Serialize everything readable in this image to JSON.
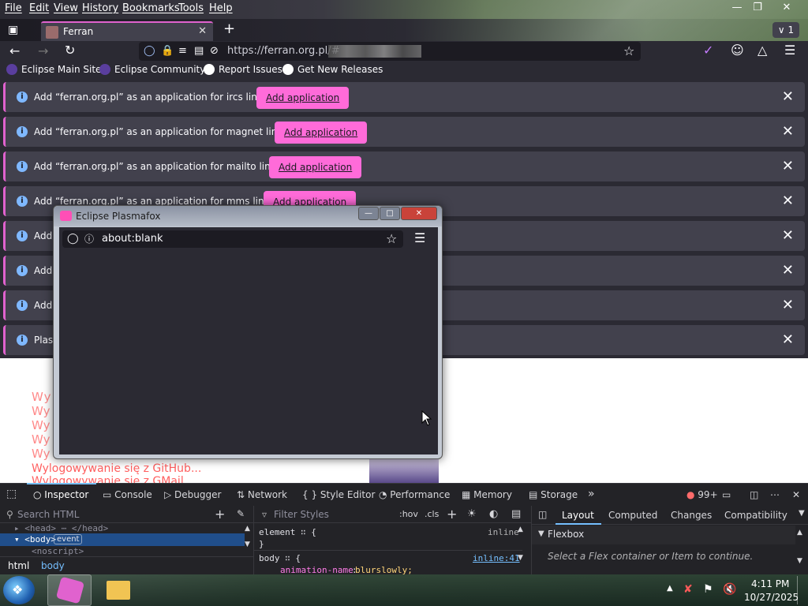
{
  "menubar": {
    "items": [
      "File",
      "Edit",
      "View",
      "History",
      "Bookmarks",
      "Tools",
      "Help"
    ]
  },
  "tabs": {
    "active_title": "Ferran",
    "count_badge": "1"
  },
  "navbar": {
    "url": "https://ferran.org.pl/#"
  },
  "bookmarks": [
    "Eclipse Main Site",
    "Eclipse Community",
    "Report Issues",
    "Get New Releases"
  ],
  "notifications": [
    {
      "message": "Add “ferran.org.pl” as an application for ircs links?",
      "button": "Add application"
    },
    {
      "message": "Add “ferran.org.pl” as an application for magnet links?",
      "button": "Add application"
    },
    {
      "message": "Add “ferran.org.pl” as an application for mailto links?",
      "button": "Add application"
    },
    {
      "message": "Add “ferran.org.pl” as an application for mms links?",
      "button": "Add application"
    },
    {
      "message": "Add",
      "button": ""
    },
    {
      "message": "Add",
      "button": ""
    },
    {
      "message": "Add",
      "button": ""
    },
    {
      "message": "Plasr",
      "button": ""
    }
  ],
  "page": {
    "lines": [
      "Wylogowywanie się z GitHub...",
      "Wylogowywanie się z GMail..."
    ]
  },
  "popup": {
    "title": "Eclipse Plasmafox",
    "url": "about:blank"
  },
  "devtools": {
    "tabs": [
      "Inspector",
      "Console",
      "Debugger",
      "Network",
      "Style Editor",
      "Performance",
      "Memory",
      "Storage"
    ],
    "error_count": "99+",
    "search_placeholder": "Search HTML",
    "tree": {
      "head_line": "<head> ⋯ </head>",
      "body_tag": "<body>",
      "event_badge": "event",
      "noscript": "<noscript>"
    },
    "breadcrumbs": [
      "html",
      "body"
    ],
    "filter_placeholder": "Filter Styles",
    "hov": ":hov",
    "cls": ".cls",
    "rules": {
      "element_line": "element ∷ {",
      "element_close": "}",
      "inline_label": "inline",
      "body_line": "body ∷ {",
      "body_source": "inline:41",
      "prop_name": "animation-name",
      "prop_value": "blurslowly;"
    },
    "layout_tabs": [
      "Layout",
      "Computed",
      "Changes",
      "Compatibility"
    ],
    "flexbox_title": "Flexbox",
    "flexbox_hint": "Select a Flex container or Item to continue."
  },
  "taskbar": {
    "time": "4:11 PM",
    "date": "10/27/2025"
  }
}
